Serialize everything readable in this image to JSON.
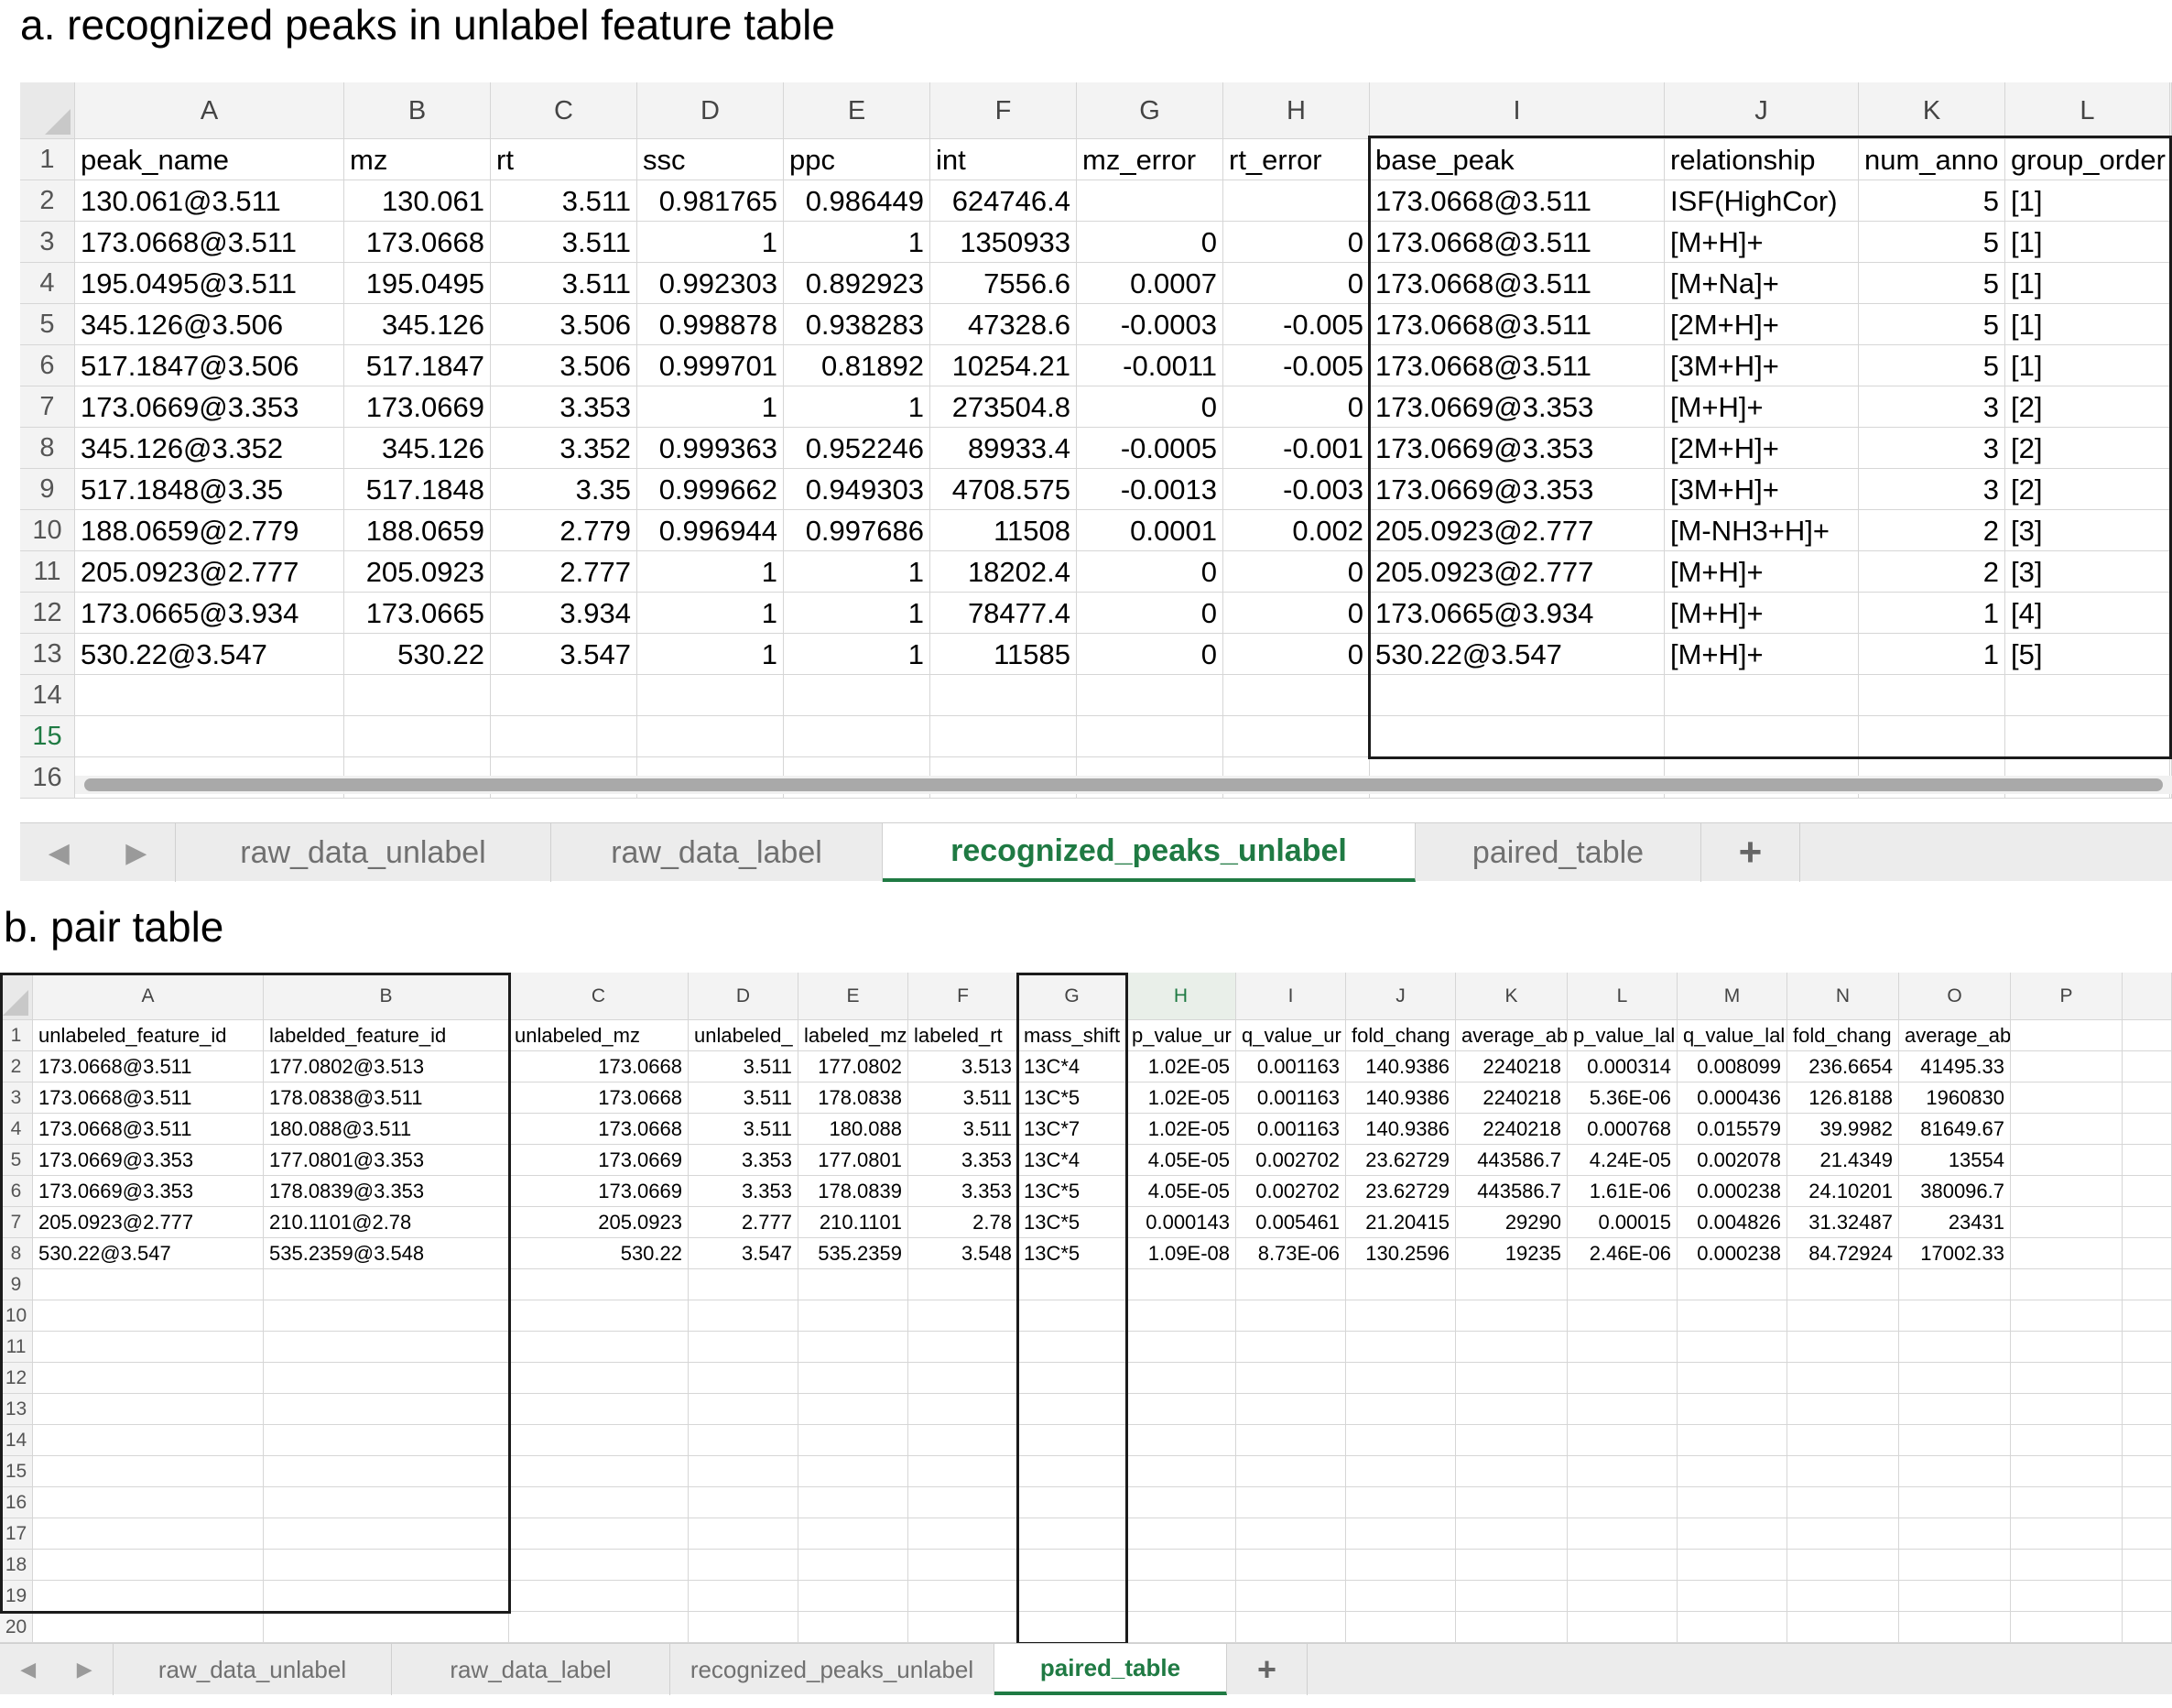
{
  "caption_a": "a. recognized peaks in unlabel feature table",
  "caption_b": "b. pair table",
  "sheet_a": {
    "columns": [
      "A",
      "B",
      "C",
      "D",
      "E",
      "F",
      "G",
      "H",
      "I",
      "J",
      "K",
      "L"
    ],
    "header": [
      "peak_name",
      "mz",
      "rt",
      "ssc",
      "ppc",
      "int",
      "mz_error",
      "rt_error",
      "base_peak",
      "relationship",
      "num_anno",
      "group_order"
    ],
    "rows": [
      [
        "130.061@3.511",
        "130.061",
        "3.511",
        "0.981765",
        "0.986449",
        "624746.4",
        "",
        "",
        "173.0668@3.511",
        "ISF(HighCor)",
        "5",
        "[1]"
      ],
      [
        "173.0668@3.511",
        "173.0668",
        "3.511",
        "1",
        "1",
        "1350933",
        "0",
        "0",
        "173.0668@3.511",
        "[M+H]+",
        "5",
        "[1]"
      ],
      [
        "195.0495@3.511",
        "195.0495",
        "3.511",
        "0.992303",
        "0.892923",
        "7556.6",
        "0.0007",
        "0",
        "173.0668@3.511",
        "[M+Na]+",
        "5",
        "[1]"
      ],
      [
        "345.126@3.506",
        "345.126",
        "3.506",
        "0.998878",
        "0.938283",
        "47328.6",
        "-0.0003",
        "-0.005",
        "173.0668@3.511",
        "[2M+H]+",
        "5",
        "[1]"
      ],
      [
        "517.1847@3.506",
        "517.1847",
        "3.506",
        "0.999701",
        "0.81892",
        "10254.21",
        "-0.0011",
        "-0.005",
        "173.0668@3.511",
        "[3M+H]+",
        "5",
        "[1]"
      ],
      [
        "173.0669@3.353",
        "173.0669",
        "3.353",
        "1",
        "1",
        "273504.8",
        "0",
        "0",
        "173.0669@3.353",
        "[M+H]+",
        "3",
        "[2]"
      ],
      [
        "345.126@3.352",
        "345.126",
        "3.352",
        "0.999363",
        "0.952246",
        "89933.4",
        "-0.0005",
        "-0.001",
        "173.0669@3.353",
        "[2M+H]+",
        "3",
        "[2]"
      ],
      [
        "517.1848@3.35",
        "517.1848",
        "3.35",
        "0.999662",
        "0.949303",
        "4708.575",
        "-0.0013",
        "-0.003",
        "173.0669@3.353",
        "[3M+H]+",
        "3",
        "[2]"
      ],
      [
        "188.0659@2.779",
        "188.0659",
        "2.779",
        "0.996944",
        "0.997686",
        "11508",
        "0.0001",
        "0.002",
        "205.0923@2.777",
        "[M-NH3+H]+",
        "2",
        "[3]"
      ],
      [
        "205.0923@2.777",
        "205.0923",
        "2.777",
        "1",
        "1",
        "18202.4",
        "0",
        "0",
        "205.0923@2.777",
        "[M+H]+",
        "2",
        "[3]"
      ],
      [
        "173.0665@3.934",
        "173.0665",
        "3.934",
        "1",
        "1",
        "78477.4",
        "0",
        "0",
        "173.0665@3.934",
        "[M+H]+",
        "1",
        "[4]"
      ],
      [
        "530.22@3.547",
        "530.22",
        "3.547",
        "1",
        "1",
        "11585",
        "0",
        "0",
        "530.22@3.547",
        "[M+H]+",
        "1",
        "[5]"
      ]
    ],
    "row_numbers": [
      "1",
      "2",
      "3",
      "4",
      "5",
      "6",
      "7",
      "8",
      "9",
      "10",
      "11",
      "12",
      "13",
      "14",
      "15",
      "16"
    ],
    "tabs": [
      "raw_data_unlabel",
      "raw_data_label",
      "recognized_peaks_unlabel",
      "paired_table"
    ],
    "active_tab": 2,
    "add_tab": "+",
    "nav_prev": "◀",
    "nav_next": "▶"
  },
  "sheet_b": {
    "columns": [
      "A",
      "B",
      "C",
      "D",
      "E",
      "F",
      "G",
      "H",
      "I",
      "J",
      "K",
      "L",
      "M",
      "N",
      "O",
      "P"
    ],
    "header": [
      "unlabeled_feature_id",
      "labelded_feature_id",
      "unlabeled_mz",
      "unlabeled_",
      "labeled_mz",
      "labeled_rt",
      "mass_shift",
      "p_value_ur",
      "q_value_ur",
      "fold_chang",
      "average_ab",
      "p_value_lal",
      "q_value_lal",
      "fold_chang",
      "average_abundance_label",
      ""
    ],
    "rows": [
      [
        "173.0668@3.511",
        "177.0802@3.513",
        "173.0668",
        "3.511",
        "177.0802",
        "3.513",
        "13C*4",
        "1.02E-05",
        "0.001163",
        "140.9386",
        "2240218",
        "0.000314",
        "0.008099",
        "236.6654",
        "41495.33",
        ""
      ],
      [
        "173.0668@3.511",
        "178.0838@3.511",
        "173.0668",
        "3.511",
        "178.0838",
        "3.511",
        "13C*5",
        "1.02E-05",
        "0.001163",
        "140.9386",
        "2240218",
        "5.36E-06",
        "0.000436",
        "126.8188",
        "1960830",
        ""
      ],
      [
        "173.0668@3.511",
        "180.088@3.511",
        "173.0668",
        "3.511",
        "180.088",
        "3.511",
        "13C*7",
        "1.02E-05",
        "0.001163",
        "140.9386",
        "2240218",
        "0.000768",
        "0.015579",
        "39.9982",
        "81649.67",
        ""
      ],
      [
        "173.0669@3.353",
        "177.0801@3.353",
        "173.0669",
        "3.353",
        "177.0801",
        "3.353",
        "13C*4",
        "4.05E-05",
        "0.002702",
        "23.62729",
        "443586.7",
        "4.24E-05",
        "0.002078",
        "21.4349",
        "13554",
        ""
      ],
      [
        "173.0669@3.353",
        "178.0839@3.353",
        "173.0669",
        "3.353",
        "178.0839",
        "3.353",
        "13C*5",
        "4.05E-05",
        "0.002702",
        "23.62729",
        "443586.7",
        "1.61E-06",
        "0.000238",
        "24.10201",
        "380096.7",
        ""
      ],
      [
        "205.0923@2.777",
        "210.1101@2.78",
        "205.0923",
        "2.777",
        "210.1101",
        "2.78",
        "13C*5",
        "0.000143",
        "0.005461",
        "21.20415",
        "29290",
        "0.00015",
        "0.004826",
        "31.32487",
        "23431",
        ""
      ],
      [
        "530.22@3.547",
        "535.2359@3.548",
        "530.22",
        "3.547",
        "535.2359",
        "3.548",
        "13C*5",
        "1.09E-08",
        "8.73E-06",
        "130.2596",
        "19235",
        "2.46E-06",
        "0.000238",
        "84.72924",
        "17002.33",
        ""
      ]
    ],
    "row_numbers": [
      "1",
      "2",
      "3",
      "4",
      "5",
      "6",
      "7",
      "8",
      "9",
      "10",
      "11",
      "12",
      "13",
      "14",
      "15",
      "16",
      "17",
      "18",
      "19",
      "20"
    ],
    "tabs": [
      "raw_data_unlabel",
      "raw_data_label",
      "recognized_peaks_unlabel",
      "paired_table"
    ],
    "active_tab": 3,
    "add_tab": "+",
    "nav_prev": "◀",
    "nav_next": "▶"
  }
}
